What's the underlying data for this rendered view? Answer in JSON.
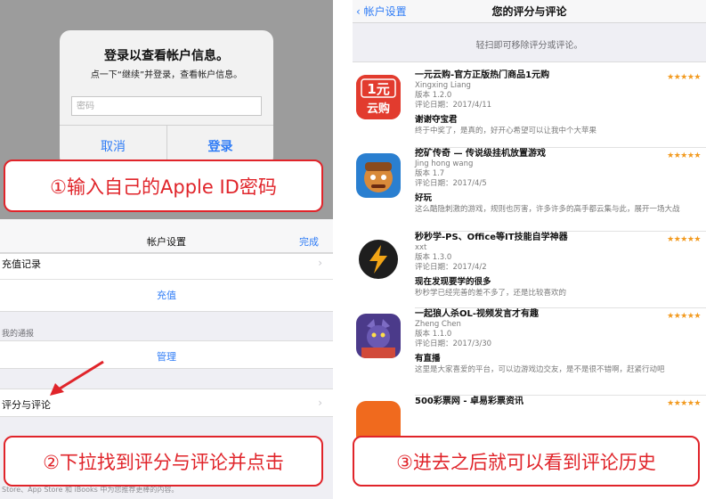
{
  "login": {
    "title": "登录以查看帐户信息。",
    "subtitle": "点一下“继续”并登录，查看帐户信息。",
    "password_placeholder": "密码",
    "cancel_label": "取消",
    "login_label": "登录"
  },
  "callouts": {
    "step1": "①输入自己的Apple ID密码",
    "step2": "②下拉找到评分与评论并点击",
    "step3": "③进去之后就可以看到评论历史"
  },
  "settings": {
    "title": "帐户设置",
    "done_label": "完成",
    "recharge_record_label": "充值记录",
    "recharge_link": "充值",
    "subscriptions_section": "我的通报",
    "manage_link": "管理",
    "reviews_label": "评分与评论",
    "footer": "Store、App Store 和 iBooks 中为您推荐更棒的内容。"
  },
  "reviews_page": {
    "back_label": "帐户设置",
    "title": "您的评分与评论",
    "hint": "轻扫即可移除评分或评论。",
    "items": [
      {
        "app_name": "一元云购-官方正版热门商品1元购",
        "author": "Xingxing Liang",
        "version": "版本 1.2.0",
        "date": "评论日期：2017/4/11",
        "review_title": "谢谢夺宝君",
        "review_body": "终于中奖了，是真的，好开心希望可以让我中个大苹果",
        "rating": "★★★★★",
        "icon_text": "1元\n云购"
      },
      {
        "app_name": "挖矿传奇 — 传说级挂机放置游戏",
        "author": "Jing hong wang",
        "version": "版本 1.7",
        "date": "评论日期：2017/4/5",
        "review_title": "好玩",
        "review_body": "这么酷隐刺激的游戏，规则也厉害，许多许多的高手都云集与此，展开一场大战",
        "rating": "★★★★★"
      },
      {
        "app_name": "秒秒学-PS、Office等IT技能自学神器",
        "author": "xxt",
        "version": "版本 1.3.0",
        "date": "评论日期：2017/4/2",
        "review_title": "现在发现要学的很多",
        "review_body": "秒秒学已经完善的差不多了，还是比较喜欢的",
        "rating": "★★★★★"
      },
      {
        "app_name": "一起狼人杀OL-视频发言才有趣",
        "author": "Zheng Chen",
        "version": "版本 1.1.0",
        "date": "评论日期：2017/3/30",
        "review_title": "有直播",
        "review_body": "这里是大家喜爱的平台，可以边游戏边交友，是不是很不错啊，赶紧行动吧",
        "rating": "★★★★★"
      },
      {
        "app_name": "500彩票网 - 卓易彩票资讯",
        "rating": "★★★★★"
      }
    ]
  },
  "colors": {
    "accent_blue": "#2f7cf6",
    "callout_red": "#e0242a",
    "star_orange": "#f29a1f"
  }
}
